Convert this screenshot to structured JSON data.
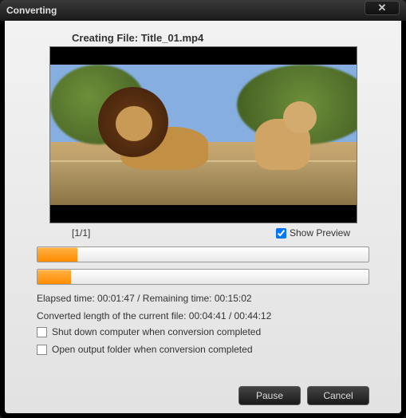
{
  "window": {
    "title": "Converting"
  },
  "creating": {
    "prefix": "Creating File:",
    "filename": "Title_01.mp4"
  },
  "progress_row": {
    "counter": "[1/1]",
    "show_preview_label": "Show Preview",
    "show_preview_checked": true
  },
  "progress": {
    "overall_pct": 12,
    "file_pct": 10
  },
  "times": {
    "elapsed_label": "Elapsed time:",
    "elapsed": "00:01:47",
    "sep": "/",
    "remaining_label": "Remaining time:",
    "remaining": "00:15:02"
  },
  "file_times": {
    "label": "Converted length of the current file:",
    "converted": "00:04:41",
    "sep": "/",
    "total": "00:44:12"
  },
  "options": {
    "shutdown": {
      "label": "Shut down computer when conversion completed",
      "checked": false
    },
    "open_folder": {
      "label": "Open output folder when conversion completed",
      "checked": false
    }
  },
  "buttons": {
    "pause": "Pause",
    "cancel": "Cancel"
  }
}
